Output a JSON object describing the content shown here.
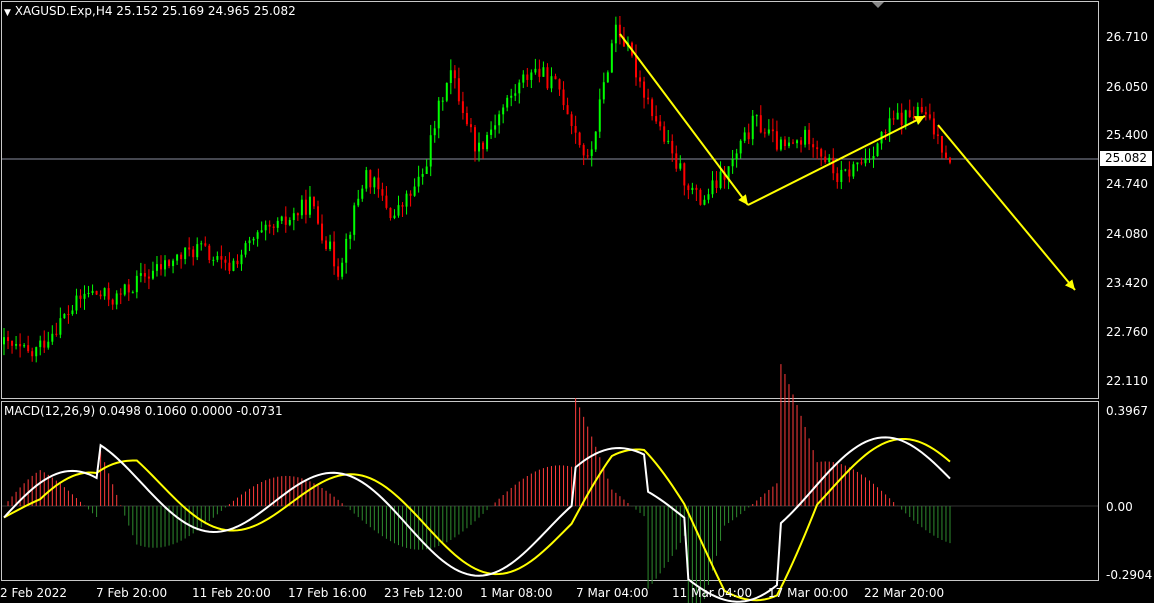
{
  "symbol_header": "XAGUSD.Exp,H4  25.152 25.169 24.965 25.082",
  "macd_header": "MACD(12,26,9) 0.0498 0.1060 0.0000 -0.0731",
  "current_price": "25.082",
  "price_axis": [
    "26.710",
    "26.050",
    "25.400",
    "24.740",
    "24.080",
    "23.420",
    "22.760",
    "22.110"
  ],
  "macd_axis": [
    "0.3967",
    "0.00",
    "-0.2904"
  ],
  "time_axis": [
    "2 Feb 2022",
    "7 Feb 20:00",
    "11 Feb 20:00",
    "17 Feb 16:00",
    "23 Feb 12:00",
    "1 Mar 08:00",
    "7 Mar 04:00",
    "11 Mar 04:00",
    "17 Mar 00:00",
    "22 Mar 20:00"
  ],
  "colors": {
    "bull": "#00ff00",
    "bear": "#ff0000",
    "arrow": "#ffff00",
    "macd_line": "#ffffff",
    "signal_line": "#ffff00",
    "hist_pos": "#ff3b3b",
    "hist_neg": "#2e8b2e"
  },
  "chart_data": {
    "type": "line",
    "title": "XAGUSD.Exp,H4",
    "ylim": [
      22.0,
      27.0
    ],
    "price_path": [
      22.6,
      22.45,
      22.9,
      23.3,
      23.2,
      23.5,
      23.7,
      23.9,
      23.6,
      24.0,
      24.2,
      24.5,
      23.6,
      24.9,
      24.3,
      24.8,
      26.3,
      25.2,
      25.8,
      26.3,
      26.0,
      25.0,
      26.9,
      26.0,
      25.1,
      24.5,
      24.9,
      25.6,
      25.2,
      25.4,
      24.8,
      25.1,
      25.6,
      25.7,
      25.1
    ],
    "macd_ylim": [
      -0.2904,
      0.3967
    ]
  }
}
